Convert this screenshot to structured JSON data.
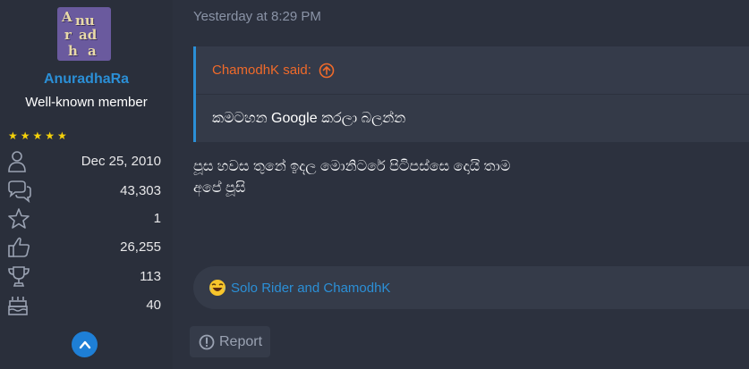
{
  "user": {
    "avatar_letters": [
      "A",
      "nu",
      "r",
      "ad",
      "h",
      "a"
    ],
    "name": "AnuradhaRa",
    "title": "Well-known member",
    "stars": "★★★★★",
    "stats": [
      {
        "icon": "user-icon",
        "value": "Dec 25, 2010"
      },
      {
        "icon": "messages-icon",
        "value": "43,303"
      },
      {
        "icon": "star-icon",
        "value": "1"
      },
      {
        "icon": "thumbs-up-icon",
        "value": "26,255"
      },
      {
        "icon": "trophy-icon",
        "value": "113"
      },
      {
        "icon": "birthday-cake-icon",
        "value": "40"
      }
    ]
  },
  "post": {
    "date": "Yesterday at 8:29 PM",
    "quote": {
      "author": "ChamodhK said:",
      "text": "කමටහන Google කරලා බලන්න"
    },
    "body_lines": [
      "පූස හවස තුනේ ඉදල මොනිටරේ පිටිපස්සෙ දොයි තාම",
      "අපේ පූසි"
    ],
    "reactions": {
      "emoji": "laughing-emoji",
      "names": "Solo Rider and ChamodhK"
    },
    "report_label": "Report"
  },
  "colors": {
    "background": "#2c313e",
    "link": "#2b8fd6",
    "quote_author": "#f06a2a",
    "stars": "#f5d20a"
  }
}
